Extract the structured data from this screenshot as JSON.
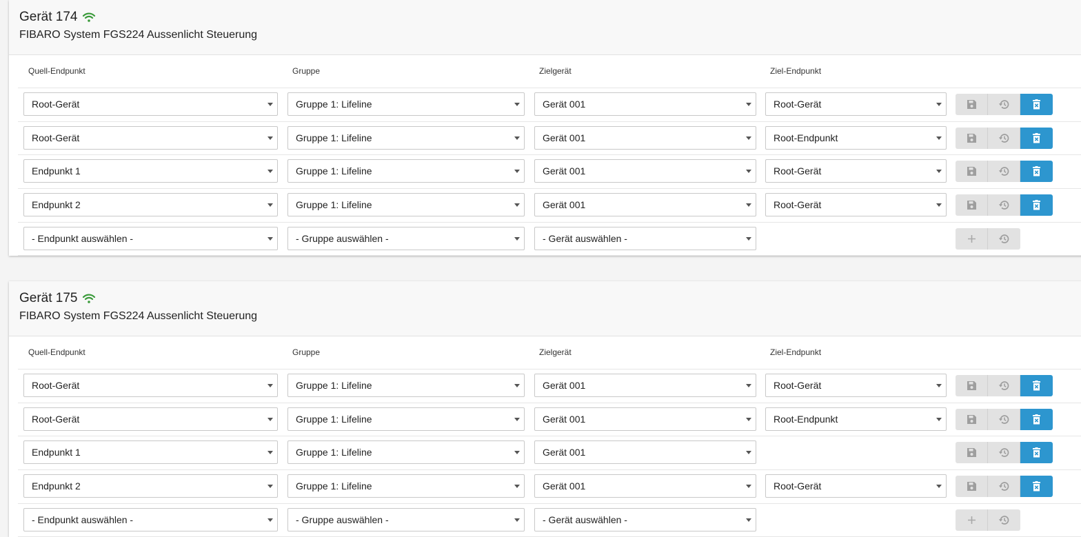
{
  "headers": {
    "source_endpoint": "Quell-Endpunkt",
    "group": "Gruppe",
    "target_device": "Zielgerät",
    "target_endpoint": "Ziel-Endpunkt"
  },
  "devices": [
    {
      "title": "Gerät 174",
      "subtitle": "FIBARO System FGS224 Aussenlicht Steuerung",
      "rows": [
        {
          "source": "Root-Gerät",
          "group": "Gruppe 1: Lifeline",
          "target": "Gerät 001",
          "target_endpoint": "Root-Gerät"
        },
        {
          "source": "Root-Gerät",
          "group": "Gruppe 1: Lifeline",
          "target": "Gerät 001",
          "target_endpoint": "Root-Endpunkt"
        },
        {
          "source": "Endpunkt 1",
          "group": "Gruppe 1: Lifeline",
          "target": "Gerät 001",
          "target_endpoint": "Root-Gerät"
        },
        {
          "source": "Endpunkt 2",
          "group": "Gruppe 1: Lifeline",
          "target": "Gerät 001",
          "target_endpoint": "Root-Gerät"
        }
      ],
      "new_row": {
        "source": "- Endpunkt auswählen -",
        "group": "- Gruppe auswählen -",
        "target": "- Gerät auswählen -"
      }
    },
    {
      "title": "Gerät 175",
      "subtitle": "FIBARO System FGS224 Aussenlicht Steuerung",
      "rows": [
        {
          "source": "Root-Gerät",
          "group": "Gruppe 1: Lifeline",
          "target": "Gerät 001",
          "target_endpoint": "Root-Gerät"
        },
        {
          "source": "Root-Gerät",
          "group": "Gruppe 1: Lifeline",
          "target": "Gerät 001",
          "target_endpoint": "Root-Endpunkt"
        },
        {
          "source": "Endpunkt 1",
          "group": "Gruppe 1: Lifeline",
          "target": "Gerät 001",
          "target_endpoint": null
        },
        {
          "source": "Endpunkt 2",
          "group": "Gruppe 1: Lifeline",
          "target": "Gerät 001",
          "target_endpoint": "Root-Gerät"
        }
      ],
      "new_row": {
        "source": "- Endpunkt auswählen -",
        "group": "- Gruppe auswählen -",
        "target": "- Gerät auswählen -"
      }
    }
  ],
  "colors": {
    "online": "#3a9a3a",
    "delete_button": "#2d96cf",
    "disabled_button": "#e2e2e2"
  },
  "icons": {
    "status": "wifi-icon",
    "save": "save-icon",
    "reset": "history-icon",
    "delete": "delete-icon",
    "add": "plus-icon"
  }
}
